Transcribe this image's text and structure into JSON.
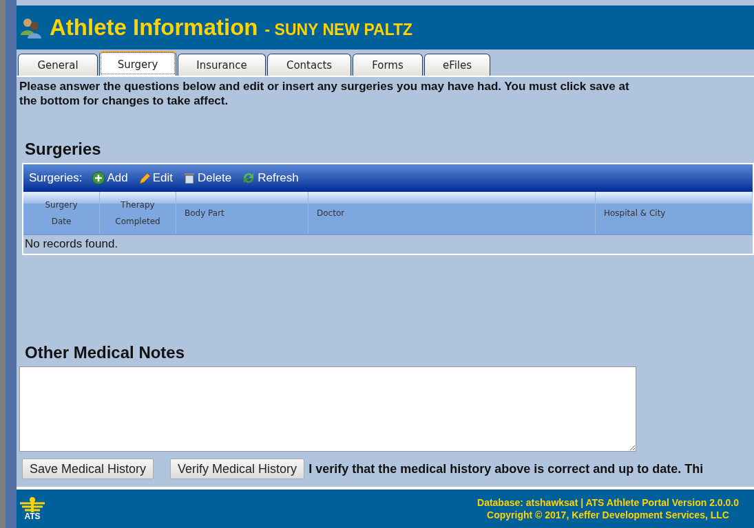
{
  "header": {
    "title": "Athlete Information",
    "subtitle": "- SUNY NEW PALTZ"
  },
  "tabs": [
    {
      "label": "General",
      "selected": false
    },
    {
      "label": "Surgery",
      "selected": true
    },
    {
      "label": "Insurance",
      "selected": false
    },
    {
      "label": "Contacts",
      "selected": false
    },
    {
      "label": "Forms",
      "selected": false
    },
    {
      "label": "eFiles",
      "selected": false
    }
  ],
  "instructions": "Please answer the questions below and edit or insert any surgeries you may have had. You must click save at the bottom for changes to take affect.",
  "surgeries": {
    "heading": "Surgeries",
    "toolbar_label": "Surgeries:",
    "actions": [
      {
        "kind": "add",
        "label": "Add"
      },
      {
        "kind": "edit",
        "label": "Edit"
      },
      {
        "kind": "delete",
        "label": "Delete"
      },
      {
        "kind": "refresh",
        "label": "Refresh"
      }
    ],
    "columns": [
      "Surgery Date",
      "Therapy Completed",
      "Body Part",
      "Doctor",
      "Hospital & City"
    ],
    "empty_message": "No records found."
  },
  "notes": {
    "heading": "Other Medical Notes"
  },
  "buttons": [
    {
      "label": "Save Medical History"
    },
    {
      "label": "Verify Medical History"
    }
  ],
  "verify_text": "I verify that the medical history above is correct and up to date. Thi",
  "footer": {
    "logo_text": "ATS",
    "database": "Database: atshawksat | ATS Athlete Portal Version 2.0.0.0",
    "copyright": "Copyright © 2017, Keffer Development Services, LLC"
  }
}
